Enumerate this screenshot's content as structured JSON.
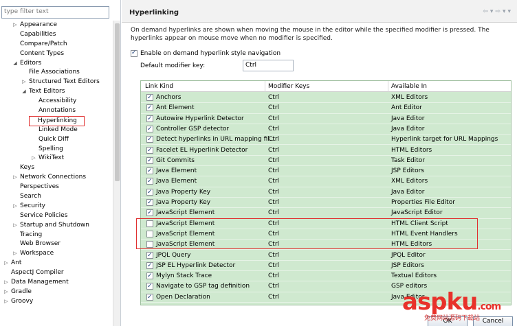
{
  "filter": {
    "placeholder": "type filter text"
  },
  "tree": [
    {
      "label": "Appearance",
      "indent": 29,
      "arrow": "▷"
    },
    {
      "label": "Capabilities",
      "indent": 29,
      "arrow": ""
    },
    {
      "label": "Compare/Patch",
      "indent": 29,
      "arrow": ""
    },
    {
      "label": "Content Types",
      "indent": 29,
      "arrow": ""
    },
    {
      "label": "Editors",
      "indent": 29,
      "arrow": "◢"
    },
    {
      "label": "File Associations",
      "indent": 42,
      "arrow": ""
    },
    {
      "label": "Structured Text Editors",
      "indent": 42,
      "arrow": "▷"
    },
    {
      "label": "Text Editors",
      "indent": 42,
      "arrow": "◢"
    },
    {
      "label": "Accessibility",
      "indent": 56,
      "arrow": ""
    },
    {
      "label": "Annotations",
      "indent": 56,
      "arrow": ""
    },
    {
      "label": "Hyperlinking",
      "indent": 56,
      "arrow": "",
      "selected": true
    },
    {
      "label": "Linked Mode",
      "indent": 56,
      "arrow": ""
    },
    {
      "label": "Quick Diff",
      "indent": 56,
      "arrow": ""
    },
    {
      "label": "Spelling",
      "indent": 56,
      "arrow": ""
    },
    {
      "label": "WikiText",
      "indent": 56,
      "arrow": "▷"
    },
    {
      "label": "Keys",
      "indent": 29,
      "arrow": ""
    },
    {
      "label": "Network Connections",
      "indent": 29,
      "arrow": "▷"
    },
    {
      "label": "Perspectives",
      "indent": 29,
      "arrow": ""
    },
    {
      "label": "Search",
      "indent": 29,
      "arrow": ""
    },
    {
      "label": "Security",
      "indent": 29,
      "arrow": "▷"
    },
    {
      "label": "Service Policies",
      "indent": 29,
      "arrow": ""
    },
    {
      "label": "Startup and Shutdown",
      "indent": 29,
      "arrow": "▷"
    },
    {
      "label": "Tracing",
      "indent": 29,
      "arrow": ""
    },
    {
      "label": "Web Browser",
      "indent": 29,
      "arrow": ""
    },
    {
      "label": "Workspace",
      "indent": 29,
      "arrow": "▷"
    },
    {
      "label": "Ant",
      "indent": 16,
      "arrow": "▷"
    },
    {
      "label": "AspectJ Compiler",
      "indent": 16,
      "arrow": ""
    },
    {
      "label": "Data Management",
      "indent": 16,
      "arrow": "▷"
    },
    {
      "label": "Gradle",
      "indent": 16,
      "arrow": "▷"
    },
    {
      "label": "Groovy",
      "indent": 16,
      "arrow": "▷"
    }
  ],
  "page": {
    "title": "Hyperlinking",
    "description": "On demand hyperlinks are shown when moving the mouse in the editor while the specified modifier is pressed. The hyperlinks appear on mouse move when no modifier is specified.",
    "enable_label": "Enable on demand hyperlink style navigation",
    "modifier_label": "Default modifier key:",
    "modifier_value": "Ctrl"
  },
  "table": {
    "columns": [
      "Link Kind",
      "Modifier Keys",
      "Available In"
    ],
    "rows": [
      {
        "kind": "Anchors",
        "keys": "Ctrl",
        "avail": "XML Editors",
        "checked": true
      },
      {
        "kind": "Ant Element",
        "keys": "Ctrl",
        "avail": "Ant Editor",
        "checked": true
      },
      {
        "kind": "Autowire Hyperlink Detector",
        "keys": "Ctrl",
        "avail": "Java Editor",
        "checked": true
      },
      {
        "kind": "Controller GSP detector",
        "keys": "Ctrl",
        "avail": "Java Editor",
        "checked": true
      },
      {
        "kind": "Detect hyperlinks in URL mapping fil...",
        "keys": "Ctrl",
        "avail": "Hyperlink target for URL Mappings",
        "checked": true
      },
      {
        "kind": "Facelet EL Hyperlink Detector",
        "keys": "Ctrl",
        "avail": "HTML Editors",
        "checked": true
      },
      {
        "kind": "Git Commits",
        "keys": "Ctrl",
        "avail": "Task Editor",
        "checked": true
      },
      {
        "kind": "Java Element",
        "keys": "Ctrl",
        "avail": "JSP Editors",
        "checked": true
      },
      {
        "kind": "Java Element",
        "keys": "Ctrl",
        "avail": "XML Editors",
        "checked": true
      },
      {
        "kind": "Java Property Key",
        "keys": "Ctrl",
        "avail": "Java Editor",
        "checked": true
      },
      {
        "kind": "Java Property Key",
        "keys": "Ctrl",
        "avail": "Properties File Editor",
        "checked": true
      },
      {
        "kind": "JavaScript Element",
        "keys": "Ctrl",
        "avail": "JavaScript Editor",
        "checked": true
      },
      {
        "kind": "JavaScript Element",
        "keys": "Ctrl",
        "avail": "HTML Client Script",
        "checked": false
      },
      {
        "kind": "JavaScript Element",
        "keys": "Ctrl",
        "avail": "HTML Event Handlers",
        "checked": false
      },
      {
        "kind": "JavaScript Element",
        "keys": "Ctrl",
        "avail": "HTML Editors",
        "checked": false
      },
      {
        "kind": "JPQL Query",
        "keys": "Ctrl",
        "avail": "JPQL Editor",
        "checked": true
      },
      {
        "kind": "JSP EL Hyperlink Detector",
        "keys": "Ctrl",
        "avail": "JSP Editors",
        "checked": true
      },
      {
        "kind": "Mylyn Stack Trace",
        "keys": "Ctrl",
        "avail": "Textual Editors",
        "checked": true
      },
      {
        "kind": "Navigate to GSP tag definition",
        "keys": "Ctrl",
        "avail": "GSP editors",
        "checked": true
      },
      {
        "kind": "Open Declaration",
        "keys": "Ctrl",
        "avail": "Java Editor",
        "checked": true
      }
    ]
  },
  "buttons": {
    "ok": "OK",
    "cancel": "Cancel"
  },
  "watermark": {
    "brand": "aspku",
    "tld": ".com",
    "sub": "免费网站源码下载站"
  }
}
